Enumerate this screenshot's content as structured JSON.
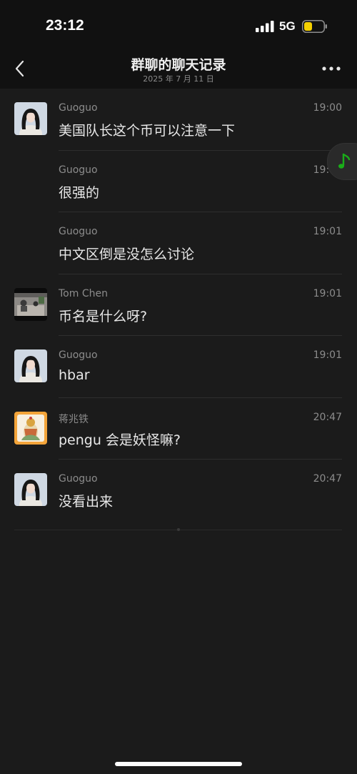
{
  "status_bar": {
    "time": "23:12",
    "network": "5G",
    "battery_color": "#f5d000"
  },
  "header": {
    "title": "群聊的聊天记录",
    "subtitle": "2025 年 7 月 11 日",
    "back_icon": "chevron-left-icon",
    "more_icon": "more-horizontal-icon"
  },
  "messages": [
    {
      "sender": "Guoguo",
      "time": "19:00",
      "text": "美国队长这个币可以注意一下",
      "show_avatar": true,
      "avatar": "guoguo"
    },
    {
      "sender": "Guoguo",
      "time": "19:00",
      "text": "很强的",
      "show_avatar": false,
      "avatar": "guoguo"
    },
    {
      "sender": "Guoguo",
      "time": "19:01",
      "text": "中文区倒是没怎么讨论",
      "show_avatar": false,
      "avatar": "guoguo"
    },
    {
      "sender": "Tom Chen",
      "time": "19:01",
      "text": "币名是什么呀?",
      "show_avatar": true,
      "avatar": "tomchen"
    },
    {
      "sender": "Guoguo",
      "time": "19:01",
      "text": "hbar",
      "show_avatar": true,
      "avatar": "guoguo"
    },
    {
      "sender": "蒋兆铁",
      "time": "20:47",
      "text": "pengu 会是妖怪嘛?",
      "show_avatar": true,
      "avatar": "jiang"
    },
    {
      "sender": "Guoguo",
      "time": "20:47",
      "text": "没看出来",
      "show_avatar": true,
      "avatar": "guoguo"
    }
  ],
  "floating": {
    "music_icon": "music-note-icon",
    "music_color": "#1aad19"
  }
}
